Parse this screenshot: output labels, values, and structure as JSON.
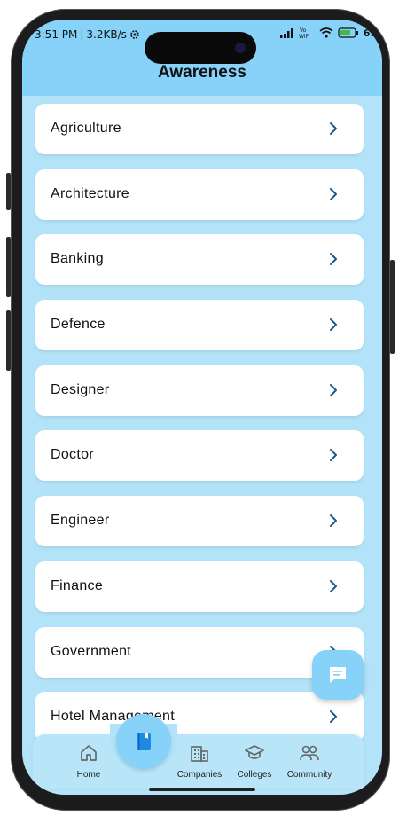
{
  "status_bar": {
    "time": "3:51 PM",
    "network_speed": "3.2KB/s",
    "battery": "61"
  },
  "header": {
    "title": "Awareness"
  },
  "categories": [
    {
      "label": "Agriculture"
    },
    {
      "label": "Architecture"
    },
    {
      "label": "Banking"
    },
    {
      "label": "Defence"
    },
    {
      "label": "Designer"
    },
    {
      "label": "Doctor"
    },
    {
      "label": "Engineer"
    },
    {
      "label": "Finance"
    },
    {
      "label": "Government"
    },
    {
      "label": "Hotel Management"
    }
  ],
  "bottom_nav": {
    "home": "Home",
    "companies": "Companies",
    "colleges": "Colleges",
    "community": "Community",
    "active": "awareness"
  },
  "colors": {
    "header_bg": "#86d2f8",
    "screen_bg": "#b3e3f8",
    "chevron": "#1a5a8a",
    "active_icon": "#1e88e5"
  }
}
